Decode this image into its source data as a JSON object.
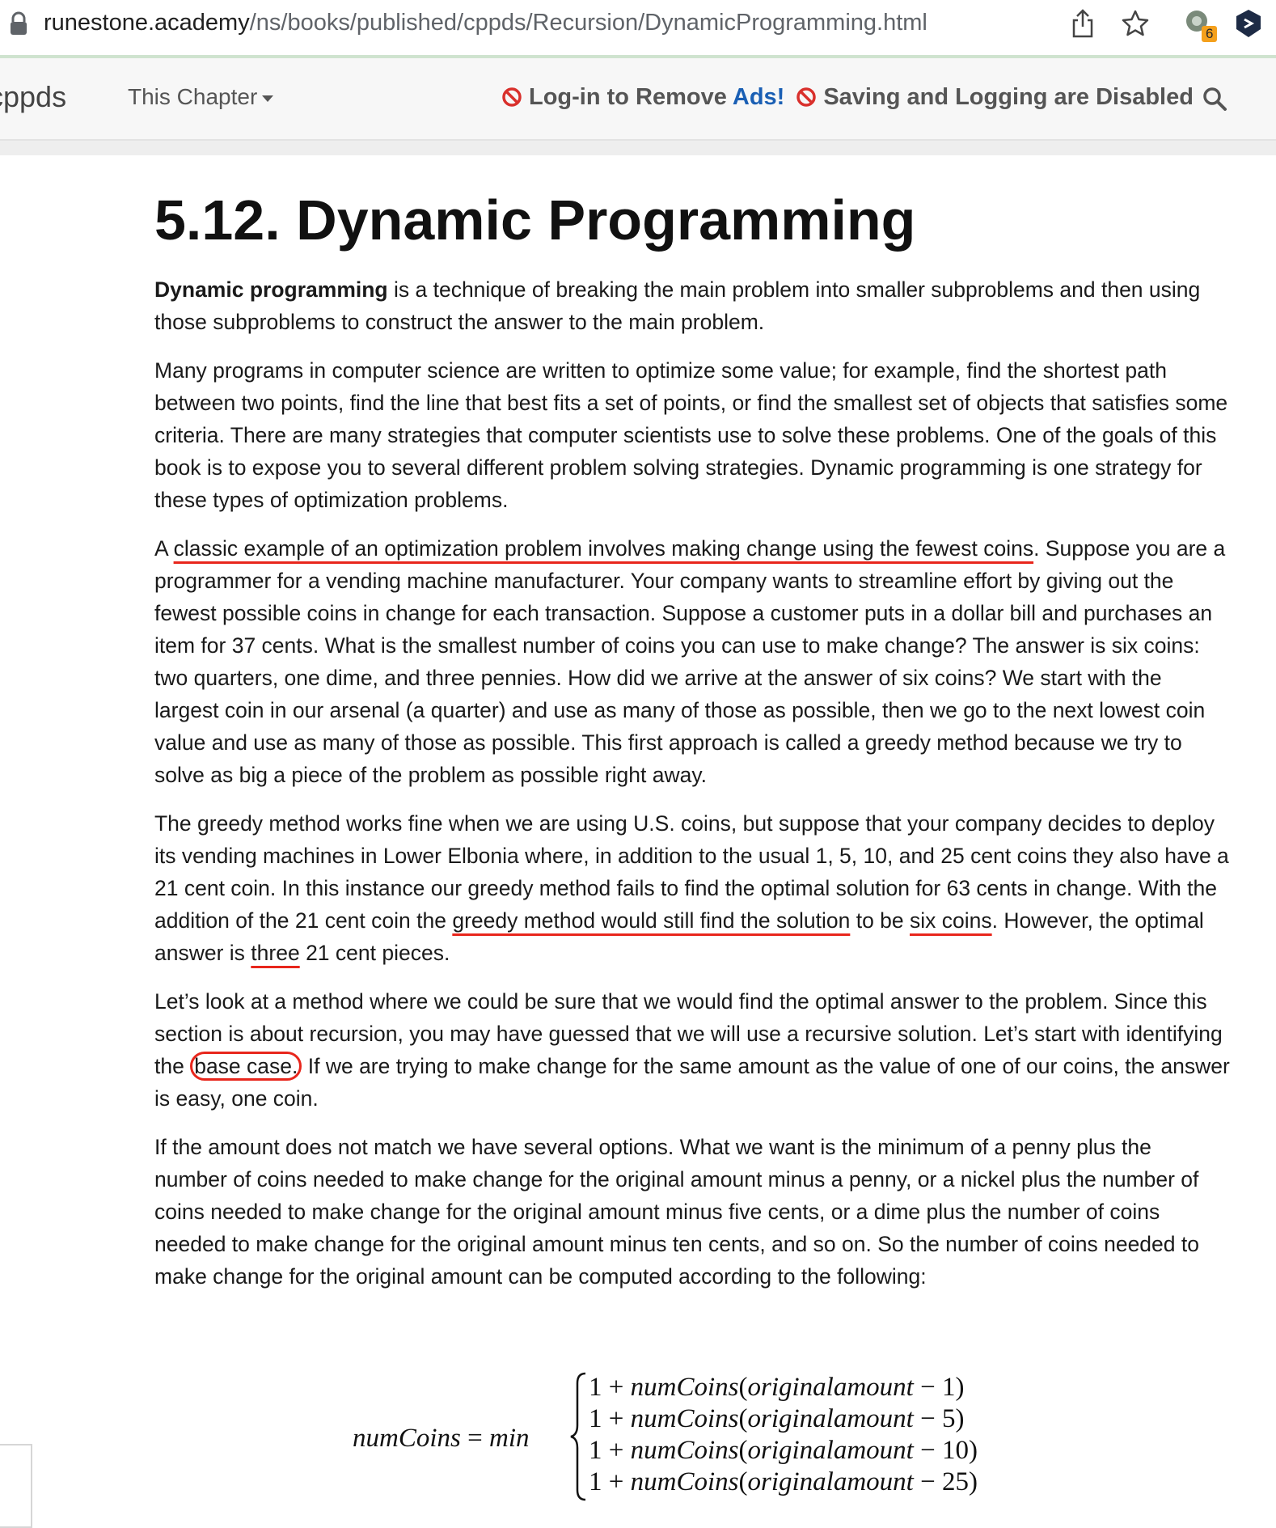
{
  "browser": {
    "url_host": "runestone.academy",
    "url_path": "/ns/books/published/cppds/Recursion/DynamicProgramming.html",
    "extension_badge": "6"
  },
  "nav": {
    "brand": "cppds",
    "chapter_menu": "This Chapter",
    "notice_login": "Log-in to Remove",
    "notice_ads": "Ads!",
    "notice_saving": "Saving and Logging are Disabled"
  },
  "article": {
    "title": "5.12. Dynamic Programming",
    "p1_bold": "Dynamic programming",
    "p1_rest": " is a technique of breaking the main problem into smaller subproblems and then using those subproblems to construct the answer to the main problem.",
    "p2": "Many programs in computer science are written to optimize some value; for example, find the shortest path between two points, find the line that best fits a set of points, or find the smallest set of objects that satisfies some criteria. There are many strategies that computer scientists use to solve these problems. One of the goals of this book is to expose you to several different problem solving strategies. Dynamic programming is one strategy for these types of optimization problems.",
    "p3_a": "A ",
    "p3_ul": "classic example of an optimization problem involves making change using the fewest coins",
    "p3_b": ". Suppose you are a programmer for a vending machine manufacturer. Your company wants to streamline effort by giving out the fewest possible coins in change for each transaction. Suppose a customer puts in a dollar bill and purchases an item for 37 cents. What is the smallest number of coins you can use to make change? The answer is six coins: two quarters, one dime, and three pennies. How did we arrive at the answer of six coins? We start with the largest coin in our arsenal (a quarter) and use as many of those as possible, then we go to the next lowest coin value and use as many of those as possible. This first approach is called a greedy method because we try to solve as big a piece of the problem as possible right away.",
    "p4_a": "The greedy method works fine when we are using U.S. coins, but suppose that your company decides to deploy its vending machines in Lower Elbonia where, in addition to the usual 1, 5, 10, and 25 cent coins they also have a 21 cent coin. In this instance our greedy method fails to find the optimal solution for 63 cents in change. With the addition of the 21 cent coin the ",
    "p4_ul1": "greedy method would still find the solution",
    "p4_b": " to be ",
    "p4_ul2": "six coins",
    "p4_c": ". However, the optimal answer is ",
    "p4_ul3": "three",
    "p4_d": " 21 cent pieces.",
    "p5_a": "Let’s look at a method where we could be sure that we would find the optimal answer to the problem. Since this section is about recursion, you may have guessed that we will use a recursive solution. Let’s start with identifying the ",
    "p5_circle": "base case.",
    "p5_b": " If we are trying to make change for the same amount as the value of one of our coins, the answer is easy, one coin.",
    "p6": "If the amount does not match we have several options. What we want is the minimum of a penny plus the number of coins needed to make change for the original amount minus a penny, or a nickel plus the number of coins needed to make change for the original amount minus five cents, or a dime plus the number of coins needed to make change for the original amount minus ten cents, and so on. So the number of coins needed to make change for the original amount can be computed according to the following:"
  },
  "equation": {
    "lhs": "numCoins",
    "equals": "=",
    "min": "min",
    "rows": [
      {
        "prefix": "1 + ",
        "func": "numCoins",
        "open": "(",
        "arg": "originalamount",
        "minus": " − ",
        "value": "1",
        "close": ")"
      },
      {
        "prefix": "1 + ",
        "func": "numCoins",
        "open": "(",
        "arg": "originalamount",
        "minus": " − ",
        "value": "5",
        "close": ")"
      },
      {
        "prefix": "1 + ",
        "func": "numCoins",
        "open": "(",
        "arg": "originalamount",
        "minus": " − ",
        "value": "10",
        "close": ")"
      },
      {
        "prefix": "1 + ",
        "func": "numCoins",
        "open": "(",
        "arg": "originalamount",
        "minus": " − ",
        "value": "25",
        "close": ")"
      }
    ]
  },
  "colors": {
    "annotation_red": "#e8261c",
    "ads_blue": "#1a5fb4",
    "ban_red": "#d9302c"
  }
}
